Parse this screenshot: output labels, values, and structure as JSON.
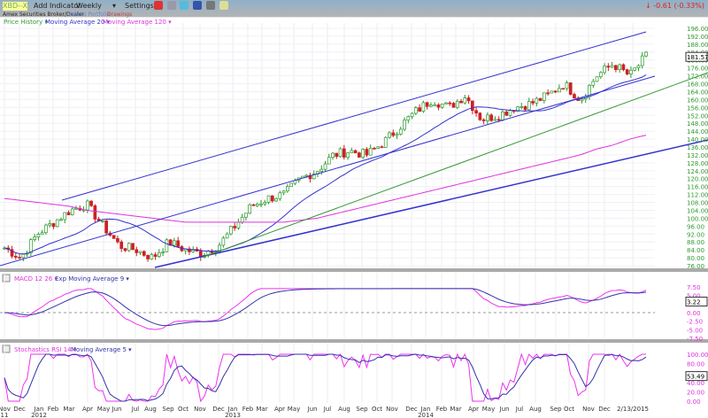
{
  "toolbar": {
    "symbol": "XBD--X",
    "add_indicator": "Add Indicator",
    "interval": "Weekly",
    "settings": "Settings",
    "exchange": "Amex Securities Broker/Dealer",
    "add_portfolio": "Add to Portfolio",
    "drawings": "Drawings",
    "change": "-0.61 (-0.33%)"
  },
  "legends": {
    "price": "Price History",
    "ma20": "Moving Average 20",
    "ma120": "Moving Average 120",
    "macd": "MACD 12 26",
    "ema9": "Exp Moving Average 9",
    "stoch": "Stochastics RSI 14",
    "ma5": "Moving Average 5"
  },
  "colors": {
    "up": "#2a9a2a",
    "down": "#cc2222",
    "ma20": "#3333cc",
    "ma120": "#dd33dd",
    "trend_blue": "#3333cc",
    "trend_green": "#339933"
  },
  "chart_data": [
    {
      "type": "candlestick",
      "title": "Price History",
      "ylim": [
        76,
        196
      ],
      "yticks": [
        "196.00",
        "192.00",
        "188.00",
        "184.00",
        "180.00",
        "176.00",
        "172.00",
        "168.00",
        "164.00",
        "160.00",
        "156.00",
        "152.00",
        "148.00",
        "144.00",
        "140.00",
        "136.00",
        "132.00",
        "128.00",
        "124.00",
        "120.00",
        "116.00",
        "112.00",
        "108.00",
        "104.00",
        "100.00",
        "96.00",
        "92.00",
        "88.00",
        "84.00",
        "80.00",
        "76.00"
      ],
      "last_value": "181.57",
      "months": [
        "Nov 11",
        "Dec 11",
        "Jan 12",
        "Feb 12",
        "Mar 12",
        "Apr 12",
        "May 12",
        "Jun 12",
        "Jul 12",
        "Aug 12",
        "Sep 12",
        "Oct 12",
        "Nov 12",
        "Dec 12",
        "Jan 13",
        "Feb 13",
        "Mar 13",
        "Apr 13",
        "May 13",
        "Jun 13",
        "Jul 13",
        "Aug 13",
        "Sep 13",
        "Oct 13",
        "Nov 13",
        "Dec 13",
        "Jan 14",
        "Feb 14",
        "Mar 14",
        "Apr 14",
        "May 14",
        "Jun 14",
        "Jul 14",
        "Aug 14",
        "Sep 14",
        "Oct 14",
        "Nov 14",
        "Dec 14",
        "Jan 15",
        "Feb 15"
      ],
      "monthly_close": [
        85,
        80,
        92,
        98,
        104,
        107,
        96,
        86,
        84,
        80,
        88,
        84,
        82,
        86,
        96,
        106,
        110,
        112,
        120,
        124,
        132,
        134,
        132,
        138,
        146,
        154,
        160,
        156,
        162,
        150,
        152,
        156,
        158,
        162,
        168,
        160,
        172,
        178,
        172,
        182
      ],
      "ma120_monthly": [
        110,
        109,
        108,
        107,
        106,
        104,
        103,
        102,
        101,
        100,
        99,
        98,
        98,
        98,
        98,
        98,
        98,
        98,
        99,
        100,
        102,
        104,
        106,
        108,
        110,
        112,
        114,
        116,
        118,
        120,
        122,
        124,
        126,
        128,
        130,
        132,
        135,
        137,
        140,
        142
      ]
    },
    {
      "type": "line",
      "title": "MACD 12 26",
      "ylim": [
        -7.5,
        7.5
      ],
      "yticks": [
        "7.50",
        "5.00",
        "0.00",
        "-2.50",
        "-5.00",
        "-7.50"
      ],
      "last_value": "3.22"
    },
    {
      "type": "line",
      "title": "Stochastics RSI 14",
      "ylim": [
        0,
        100
      ],
      "yticks": [
        "100.00",
        "80.00",
        "60.00",
        "40.00",
        "20.00",
        "0.00"
      ],
      "last_value": "53.49"
    }
  ],
  "xaxis": [
    {
      "l": "Nov",
      "y": "11"
    },
    {
      "l": "Dec"
    },
    {
      "l": "Jan",
      "y": "2012"
    },
    {
      "l": "Feb"
    },
    {
      "l": "Mar"
    },
    {
      "l": "Apr"
    },
    {
      "l": "May"
    },
    {
      "l": "Jun"
    },
    {
      "l": "Jul"
    },
    {
      "l": "Aug"
    },
    {
      "l": "Sep"
    },
    {
      "l": "Oct"
    },
    {
      "l": "Nov"
    },
    {
      "l": "Dec"
    },
    {
      "l": "Jan",
      "y": "2013"
    },
    {
      "l": "Feb"
    },
    {
      "l": "Mar"
    },
    {
      "l": "Apr"
    },
    {
      "l": "May"
    },
    {
      "l": "Jun"
    },
    {
      "l": "Jul"
    },
    {
      "l": "Aug"
    },
    {
      "l": "Sep"
    },
    {
      "l": "Oct"
    },
    {
      "l": "Nov"
    },
    {
      "l": "Dec"
    },
    {
      "l": "Jan",
      "y": "2014"
    },
    {
      "l": "Feb"
    },
    {
      "l": "Mar"
    },
    {
      "l": "Apr"
    },
    {
      "l": "May"
    },
    {
      "l": "Jun"
    },
    {
      "l": "Jul"
    },
    {
      "l": "Aug"
    },
    {
      "l": "Sep"
    },
    {
      "l": "Oct"
    },
    {
      "l": "Nov"
    },
    {
      "l": "Dec"
    },
    {
      "l": "2/13/2015"
    }
  ]
}
